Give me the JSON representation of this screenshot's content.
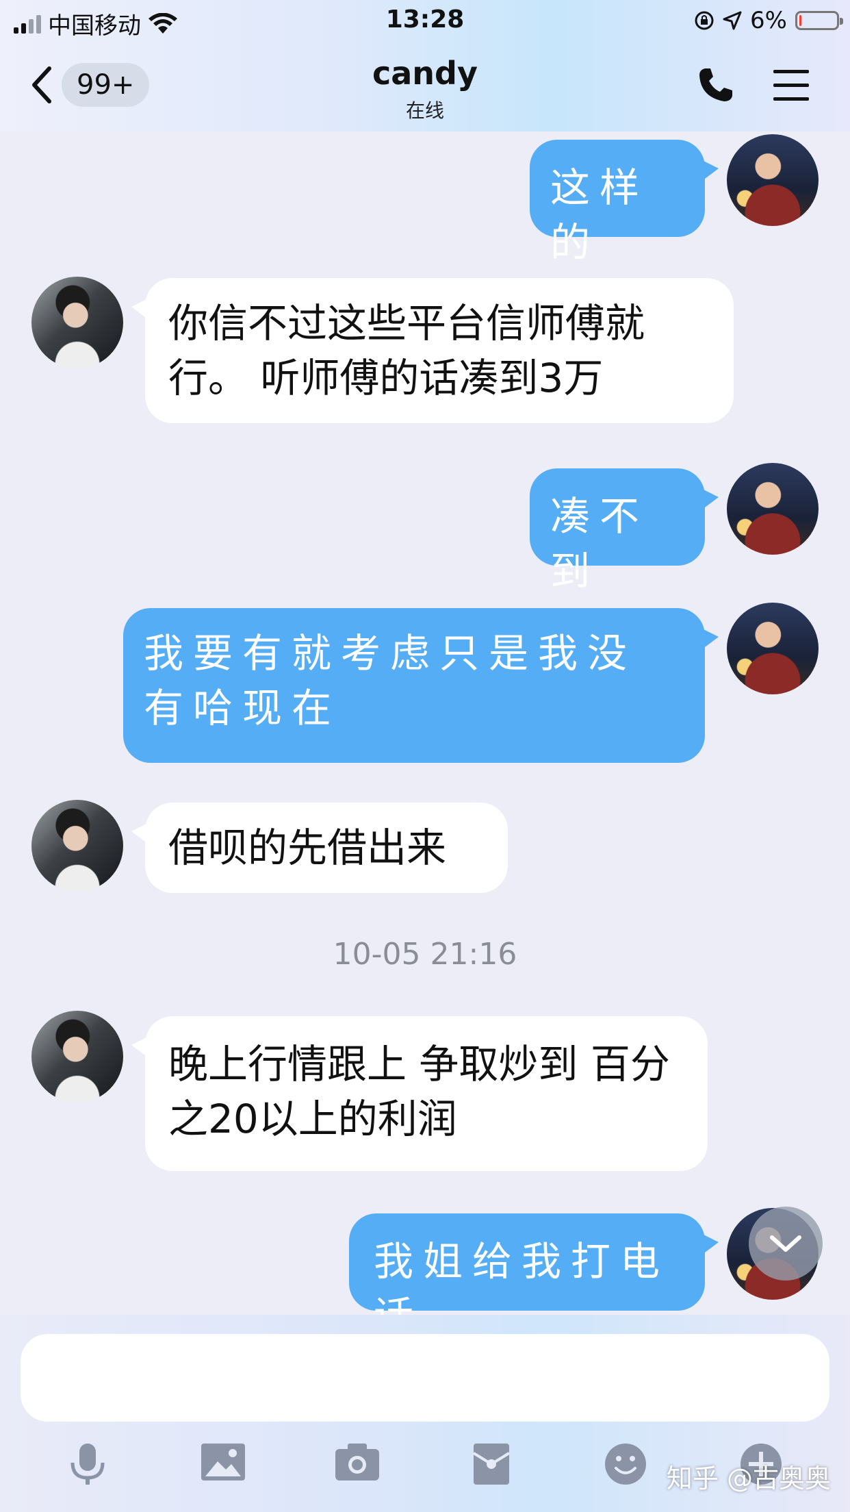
{
  "status_bar": {
    "carrier": "中国移动",
    "time": "13:28",
    "battery": "6%",
    "battery_level": 0.06
  },
  "header": {
    "back_icon": "chevron-left-icon",
    "unread_badge": "99+",
    "title": "candy",
    "subtitle": "在线",
    "call_icon": "phone-icon",
    "menu_icon": "hamburger-menu-icon"
  },
  "messages": [
    {
      "side": "sent",
      "text": "这样的"
    },
    {
      "side": "received",
      "text": "你信不过这些平台信师傅就行。 听师傅的话凑到3万"
    },
    {
      "side": "sent",
      "text": "凑不到"
    },
    {
      "side": "sent",
      "text": "我要有就考虑只是我没有哈现在"
    },
    {
      "side": "received",
      "text": "借呗的先借出来"
    },
    {
      "side": "received",
      "text": "晚上行情跟上 争取炒到 百分之20以上的利润"
    },
    {
      "side": "sent",
      "text": "我姐给我打电话"
    }
  ],
  "timestamp": "10-05 21:16",
  "input": {
    "placeholder": ""
  },
  "toolbar": {
    "icons": [
      "microphone-icon",
      "image-icon",
      "camera-icon",
      "red-packet-icon",
      "emoji-icon",
      "plus-icon"
    ]
  },
  "watermark": "知乎 @古奥奥",
  "colors": {
    "sent_bubble": "#55aef5",
    "received_bubble": "#ffffff",
    "background": "#ecedf6"
  }
}
